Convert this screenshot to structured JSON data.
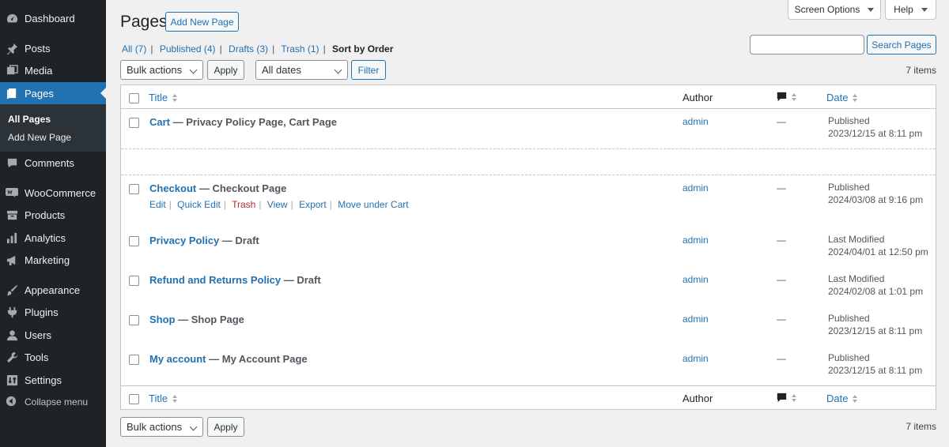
{
  "sidebar": {
    "items": [
      {
        "label": "Dashboard",
        "icon": "dashboard-icon"
      },
      {
        "label": "Posts",
        "icon": "pin-icon"
      },
      {
        "label": "Media",
        "icon": "media-icon"
      },
      {
        "label": "Pages",
        "icon": "pages-icon"
      },
      {
        "label": "Comments",
        "icon": "comment-icon"
      },
      {
        "label": "WooCommerce",
        "icon": "woo-icon"
      },
      {
        "label": "Products",
        "icon": "archive-icon"
      },
      {
        "label": "Analytics",
        "icon": "chart-bar-icon"
      },
      {
        "label": "Marketing",
        "icon": "megaphone-icon"
      },
      {
        "label": "Appearance",
        "icon": "brush-icon"
      },
      {
        "label": "Plugins",
        "icon": "plugin-icon"
      },
      {
        "label": "Users",
        "icon": "user-icon"
      },
      {
        "label": "Tools",
        "icon": "wrench-icon"
      },
      {
        "label": "Settings",
        "icon": "settings-icon"
      }
    ],
    "submenu": [
      "All Pages",
      "Add New Page"
    ],
    "collapse_label": "Collapse menu"
  },
  "header": {
    "title": "Pages",
    "add_new_label": "Add New Page",
    "screen_options_label": "Screen Options",
    "help_label": "Help"
  },
  "filters": {
    "all": "All",
    "all_count": "(7)",
    "published": "Published",
    "published_count": "(4)",
    "drafts": "Drafts",
    "drafts_count": "(3)",
    "trash": "Trash",
    "trash_count": "(1)",
    "sort_by_order": "Sort by Order",
    "separator": "|"
  },
  "search": {
    "button_label": "Search Pages"
  },
  "bulk": {
    "top_select": "Bulk actions",
    "top_apply": "Apply",
    "dates_select": "All dates",
    "filter_label": "Filter",
    "bottom_select": "Bulk actions",
    "bottom_apply": "Apply",
    "items_count": "7 items"
  },
  "table": {
    "columns": {
      "title": "Title",
      "author": "Author",
      "date": "Date"
    },
    "rows": [
      {
        "title": "Cart",
        "state": " — Privacy Policy Page, Cart Page",
        "author": "admin",
        "comments": "—",
        "status": "Published",
        "date": "2023/12/15 at 8:11 pm"
      },
      {
        "title": "Checkout",
        "state": " — Checkout Page",
        "author": "admin",
        "comments": "—",
        "status": "Published",
        "date": "2024/03/08 at 9:16 pm"
      },
      {
        "title": "Privacy Policy",
        "state": " — Draft",
        "author": "admin",
        "comments": "—",
        "status": "Last Modified",
        "date": "2024/04/01 at 12:50 pm"
      },
      {
        "title": "Refund and Returns Policy",
        "state": " — Draft",
        "author": "admin",
        "comments": "—",
        "status": "Last Modified",
        "date": "2024/02/08 at 1:01 pm"
      },
      {
        "title": "Shop",
        "state": " — Shop Page",
        "author": "admin",
        "comments": "—",
        "status": "Published",
        "date": "2023/12/15 at 8:11 pm"
      },
      {
        "title": "My account",
        "state": " — My Account Page",
        "author": "admin",
        "comments": "—",
        "status": "Published",
        "date": "2023/12/15 at 8:11 pm"
      }
    ],
    "row_actions": [
      "Edit",
      "Quick Edit",
      "Trash",
      "View",
      "Export",
      "Move under Cart"
    ]
  },
  "colors": {
    "sidebar_bg": "#1d2327",
    "accent": "#2271b1",
    "trash": "#b32d2e"
  }
}
